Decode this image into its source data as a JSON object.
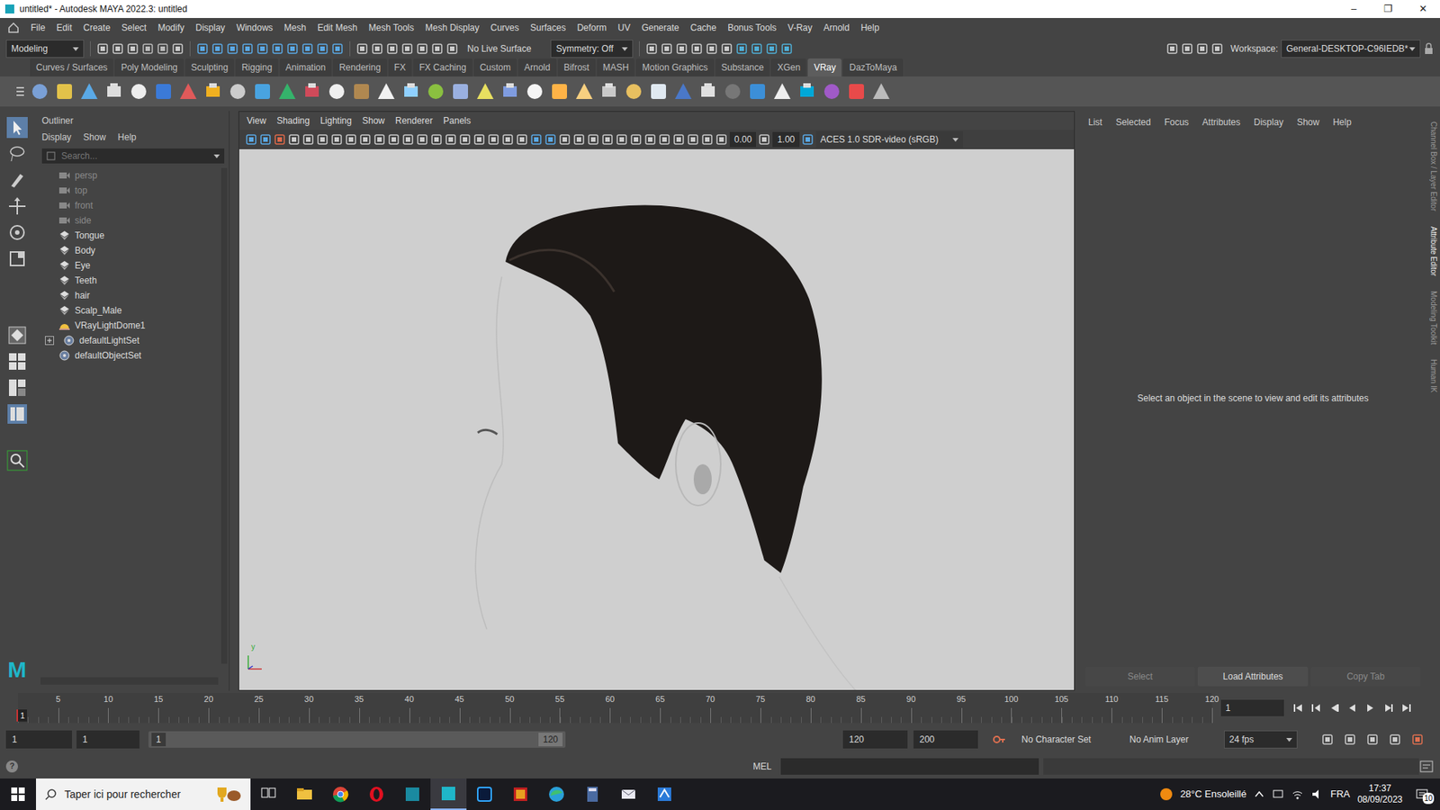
{
  "window": {
    "title": "untitled* - Autodesk MAYA 2022.3: untitled",
    "controls": [
      "–",
      "❐",
      "✕"
    ]
  },
  "menu": [
    "File",
    "Edit",
    "Create",
    "Select",
    "Modify",
    "Display",
    "Windows",
    "Mesh",
    "Edit Mesh",
    "Mesh Tools",
    "Mesh Display",
    "Curves",
    "Surfaces",
    "Deform",
    "UV",
    "Generate",
    "Cache",
    "Bonus Tools",
    "V-Ray",
    "Arnold",
    "Help"
  ],
  "status_line": {
    "mode": "Modeling",
    "live_surface": "No Live Surface",
    "symmetry": "Symmetry: Off",
    "workspace_label": "Workspace:",
    "workspace": "General-DESKTOP-C96IEDB*"
  },
  "shelf_tabs": [
    {
      "label": "Curves / Surfaces",
      "selected": false
    },
    {
      "label": "Poly Modeling",
      "selected": false
    },
    {
      "label": "Sculpting",
      "selected": false
    },
    {
      "label": "Rigging",
      "selected": false
    },
    {
      "label": "Animation",
      "selected": false
    },
    {
      "label": "Rendering",
      "selected": false
    },
    {
      "label": "FX",
      "selected": false
    },
    {
      "label": "FX Caching",
      "selected": false
    },
    {
      "label": "Custom",
      "selected": false
    },
    {
      "label": "Arnold",
      "selected": false
    },
    {
      "label": "Bifrost",
      "selected": false
    },
    {
      "label": "MASH",
      "selected": false
    },
    {
      "label": "Motion Graphics",
      "selected": false
    },
    {
      "label": "Substance",
      "selected": false
    },
    {
      "label": "XGen",
      "selected": false
    },
    {
      "label": "VRay",
      "selected": true
    },
    {
      "label": "DazToMaya",
      "selected": false
    }
  ],
  "toolbox": {
    "logo": "M"
  },
  "outliner": {
    "title": "Outliner",
    "menu": [
      "Display",
      "Show",
      "Help"
    ],
    "search_placeholder": "Search...",
    "items": [
      {
        "name": "persp",
        "kind": "camera",
        "dimmed": true,
        "expanded": false,
        "expandable": false
      },
      {
        "name": "top",
        "kind": "camera",
        "dimmed": true,
        "expanded": false,
        "expandable": false
      },
      {
        "name": "front",
        "kind": "camera",
        "dimmed": true,
        "expanded": false,
        "expandable": false
      },
      {
        "name": "side",
        "kind": "camera",
        "dimmed": true,
        "expanded": false,
        "expandable": false
      },
      {
        "name": "Tongue",
        "kind": "mesh",
        "dimmed": false,
        "expanded": false,
        "expandable": false
      },
      {
        "name": "Body",
        "kind": "mesh",
        "dimmed": false,
        "expanded": false,
        "expandable": false
      },
      {
        "name": "Eye",
        "kind": "mesh",
        "dimmed": false,
        "expanded": false,
        "expandable": false
      },
      {
        "name": "Teeth",
        "kind": "mesh",
        "dimmed": false,
        "expanded": false,
        "expandable": false
      },
      {
        "name": "hair",
        "kind": "mesh",
        "dimmed": false,
        "expanded": false,
        "expandable": false
      },
      {
        "name": "Scalp_Male",
        "kind": "mesh",
        "dimmed": false,
        "expanded": false,
        "expandable": false
      },
      {
        "name": "VRayLightDome1",
        "kind": "light",
        "dimmed": false,
        "expanded": false,
        "expandable": false
      },
      {
        "name": "defaultLightSet",
        "kind": "set",
        "dimmed": false,
        "expanded": false,
        "expandable": true
      },
      {
        "name": "defaultObjectSet",
        "kind": "set",
        "dimmed": false,
        "expanded": false,
        "expandable": false
      }
    ]
  },
  "viewport": {
    "menu": [
      "View",
      "Shading",
      "Lighting",
      "Show",
      "Renderer",
      "Panels"
    ],
    "exposure": "0.00",
    "gamma": "1.00",
    "color_space": "ACES 1.0 SDR-video (sRGB)",
    "axis_label": "y"
  },
  "attribute_editor": {
    "menu": [
      "List",
      "Selected",
      "Focus",
      "Attributes",
      "Display",
      "Show",
      "Help"
    ],
    "message": "Select an object in the scene to view and edit its attributes",
    "buttons": [
      {
        "label": "Select",
        "disabled": true
      },
      {
        "label": "Load Attributes",
        "disabled": false
      },
      {
        "label": "Copy Tab",
        "disabled": true
      }
    ]
  },
  "side_tabs": [
    {
      "label": "Channel Box / Layer Editor",
      "selected": false
    },
    {
      "label": "Attribute Editor",
      "selected": true
    },
    {
      "label": "Modeling Toolkit",
      "selected": false
    },
    {
      "label": "Human IK",
      "selected": false
    }
  ],
  "timeline": {
    "ticks": [
      "5",
      "10",
      "15",
      "20",
      "25",
      "30",
      "35",
      "40",
      "45",
      "50",
      "55",
      "60",
      "65",
      "70",
      "75",
      "80",
      "85",
      "90",
      "95",
      "100",
      "105",
      "110",
      "115",
      "120"
    ],
    "marker": "1",
    "level": 0,
    "current_frame": "1"
  },
  "range": {
    "anim_start": "1",
    "play_start": "1",
    "slider_start": "1",
    "slider_end": "120",
    "play_end": "120",
    "anim_end": "200",
    "character_set": "No Character Set",
    "anim_layer": "No Anim Layer",
    "fps": "24 fps"
  },
  "command_line": {
    "help": "?",
    "language": "MEL"
  },
  "taskbar": {
    "search": "Taper ici pour rechercher",
    "weather": "28°C Ensoleillé",
    "language": "FRA",
    "time": "17:37",
    "date": "08/09/2023",
    "notifications": "10"
  }
}
